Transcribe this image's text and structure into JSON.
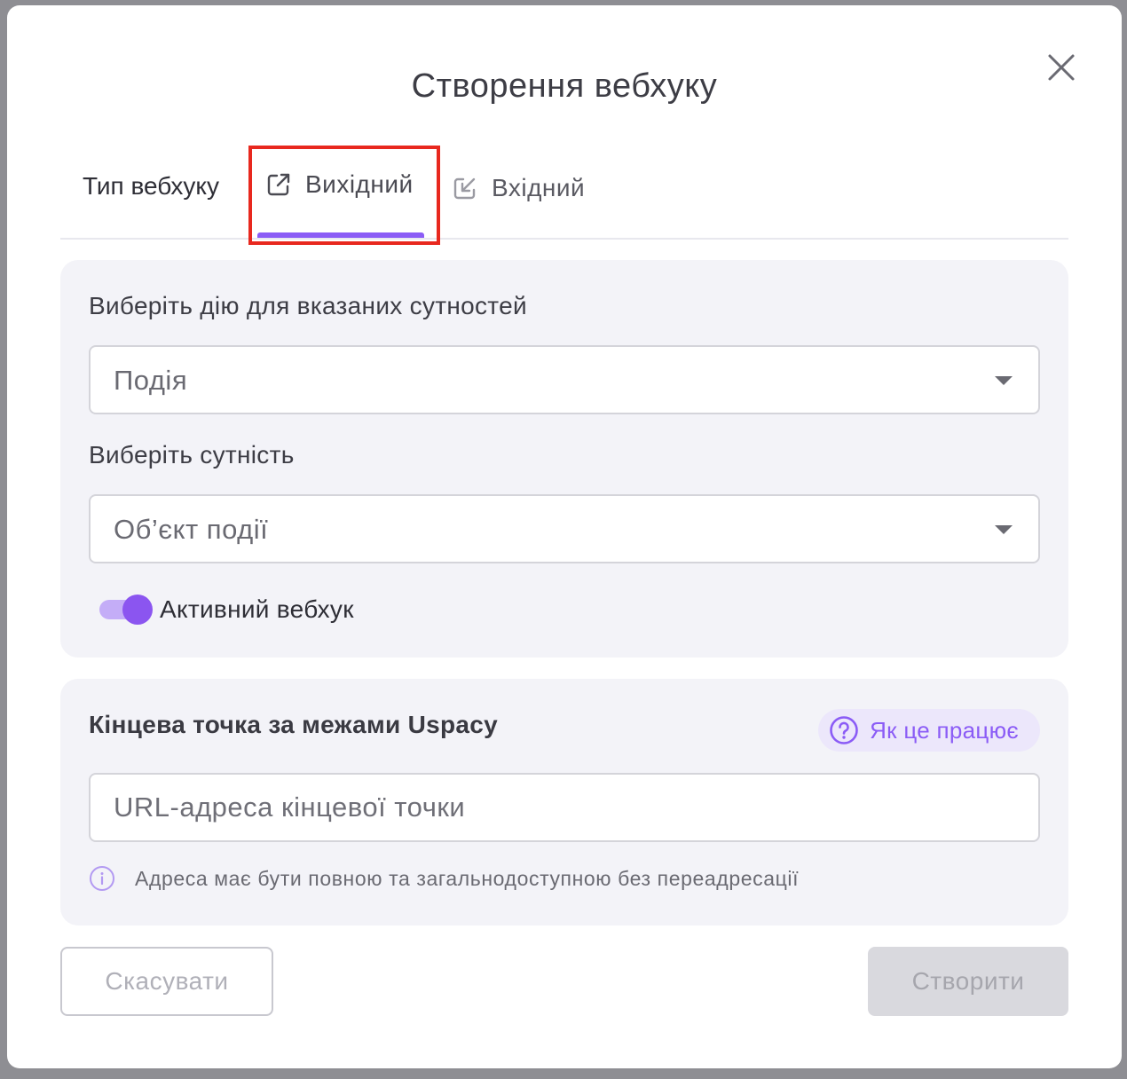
{
  "dialog": {
    "title": "Створення вебхуку",
    "close_icon": "close-icon"
  },
  "tabs": {
    "label": "Тип вебхуку",
    "items": [
      {
        "label": "Вихідний",
        "icon": "external-link-icon",
        "active": true
      },
      {
        "label": "Вхідний",
        "icon": "incoming-arrow-icon",
        "active": false
      }
    ]
  },
  "trigger": {
    "action_label": "Виберіть дію для вказаних сутностей",
    "action_value": "Подія",
    "entity_label": "Виберіть сутність",
    "entity_value": "Об’єкт події",
    "toggle_label": "Активний вебхук",
    "toggle_on": true
  },
  "endpoint": {
    "title": "Кінцева точка за межами Uspacy",
    "help_label": "Як це працює",
    "placeholder": "URL-адреса кінцевої точки",
    "hint": "Адреса має бути повною та загальнодоступною без переадресації"
  },
  "footer": {
    "cancel_label": "Скасувати",
    "create_label": "Створити"
  },
  "colors": {
    "accent": "#8b5cf6",
    "highlight": "#e8281e"
  }
}
